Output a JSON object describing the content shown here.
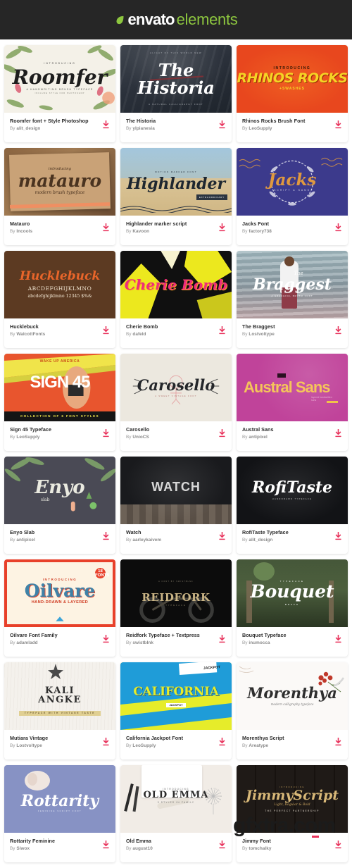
{
  "header": {
    "logo_primary": "envato",
    "logo_secondary": "elements",
    "leaf_icon": "leaf-icon",
    "bg_color": "#262626",
    "accent_color": "#8dc63f"
  },
  "watermark": {
    "text": "gfxtra.com"
  },
  "download_icon_color": "#e8335c",
  "cards": [
    {
      "title": "Roomfer font + Style Photoshop",
      "by_prefix": "By ",
      "author": "alit_design",
      "thumb": {
        "class": "t-roomfer",
        "top": "INTRODUCING",
        "main": "Roomfer",
        "sub": "A HANDWRITING BRUSH TYPEFACE",
        "sub2": "INCLUDE STYLE FOR PHOTOSHOP"
      }
    },
    {
      "title": "The Historia",
      "by_prefix": "By ",
      "author": "ylpianesia",
      "thumb": {
        "class": "t-historia",
        "top": "ALIGHT OF THIS WORLD NEW",
        "main": "The Historia",
        "sub": "A NATURAL CALLIGRAPHY FONT",
        "sub2": ""
      }
    },
    {
      "title": "Rhinos Rocks Brush Font",
      "by_prefix": "By ",
      "author": "LeoSupply",
      "thumb": {
        "class": "t-rhinos",
        "top": "INTRODUCING",
        "main": "RHINOS ROCKS",
        "sub": "+SWASHES",
        "sub2": ""
      }
    },
    {
      "title": "Matauro",
      "by_prefix": "By ",
      "author": "Incools",
      "thumb": {
        "class": "t-matauro",
        "top": "introducing",
        "main": "matauro",
        "sub": "modern brush typeface",
        "sub2": ""
      }
    },
    {
      "title": "Highlander marker script",
      "by_prefix": "By ",
      "author": "Kavoon",
      "thumb": {
        "class": "t-highlander",
        "top": "MOTION MARKER FONT",
        "main": "Highlander",
        "sub": "EXTRAORDINARY",
        "sub2": ""
      }
    },
    {
      "title": "Jacks Font",
      "by_prefix": "By ",
      "author": "factory738",
      "thumb": {
        "class": "t-jacks",
        "top": "",
        "main": "Jacks",
        "sub": "SCRIPT & SANS",
        "sub2": ""
      }
    },
    {
      "title": "Hucklebuck",
      "by_prefix": "By ",
      "author": "WalcottFonts",
      "thumb": {
        "class": "t-huckle",
        "top": "",
        "main": "Hucklebuck",
        "sub": "ABCDEFGHIJKLMNO",
        "sub2": "abcdefghijklmno 12345 $%&"
      }
    },
    {
      "title": "Cherie Bomb",
      "by_prefix": "By ",
      "author": "dafeld",
      "thumb": {
        "class": "t-cherie",
        "top": "",
        "main": "Cherie Bomb",
        "sub": "",
        "sub2": ""
      }
    },
    {
      "title": "The Braggest",
      "by_prefix": "By ",
      "author": "Lostvoltype",
      "thumb": {
        "class": "t-braggest",
        "top": "The",
        "main": "Braggest",
        "sub": "A GRACEFUL BRUSH FONT",
        "sub2": ""
      }
    },
    {
      "title": "Sign 45 Typeface",
      "by_prefix": "By ",
      "author": "LeoSupply",
      "thumb": {
        "class": "t-sign45",
        "top": "WAKE UP AMERICA",
        "main": "SIGN 45",
        "sub": "COLLECTION OF 6 FONT STYLES",
        "sub2": ""
      }
    },
    {
      "title": "Carosello",
      "by_prefix": "By ",
      "author": "UnioCS",
      "thumb": {
        "class": "t-carosello",
        "top": "",
        "main": "Carosello",
        "sub": "A SWEET VINTAGE FONT",
        "sub2": ""
      }
    },
    {
      "title": "Austral Sans",
      "by_prefix": "By ",
      "author": "antipixel",
      "thumb": {
        "class": "t-austral",
        "top": "",
        "main": "Austral Sans",
        "sub": "layered handwritten sans",
        "sub2": ""
      }
    },
    {
      "title": "Enyo Slab",
      "by_prefix": "By ",
      "author": "antipixel",
      "thumb": {
        "class": "t-enyo",
        "top": "",
        "main": "Enyo",
        "sub": "slab",
        "sub2": ""
      }
    },
    {
      "title": "Watch",
      "by_prefix": "By ",
      "author": "aarleykaivem",
      "thumb": {
        "class": "t-watch",
        "top": "",
        "main": "WATCH",
        "sub": "",
        "sub2": ""
      }
    },
    {
      "title": "RofiTaste Typeface",
      "by_prefix": "By ",
      "author": "alit_design",
      "thumb": {
        "class": "t-rofi",
        "top": "",
        "main": "RofiTaste",
        "sub": "HANDDRAWN TYPEFACE",
        "sub2": ""
      }
    },
    {
      "title": "Oilvare Font Family",
      "by_prefix": "By ",
      "author": "adamladd",
      "thumb": {
        "class": "t-oilvare",
        "top": "INTRODUCING",
        "main": "Oilvare",
        "sub": "HAND-DRAWN & LAYERED",
        "sub2": "18 FONTS"
      }
    },
    {
      "title": "Reidfork Typeface + Textpress",
      "by_prefix": "By ",
      "author": "swistblnk",
      "thumb": {
        "class": "t-reidfork",
        "top": "A FONT BY SWISTBLNK",
        "main": "REIDFORK",
        "sub": "TYPEFACE",
        "sub2": ""
      }
    },
    {
      "title": "Bouquet Typeface",
      "by_prefix": "By ",
      "author": "inumocca",
      "thumb": {
        "class": "t-bouquet",
        "top": "TYPEFACE",
        "main": "Bouquet",
        "sub": "BRAVO",
        "sub2": ""
      }
    },
    {
      "title": "Mutiara Vintage",
      "by_prefix": "By ",
      "author": "Lostvoltype",
      "thumb": {
        "class": "t-mutiara",
        "top": "KALI",
        "main": "ANGKE",
        "sub": "TYPEFACE WITH VINTAGE TASTE",
        "sub2": ""
      }
    },
    {
      "title": "California Jackpot Font",
      "by_prefix": "By ",
      "author": "LeoSupply",
      "thumb": {
        "class": "t-california",
        "top": "JACKPOT",
        "main": "CALIFORNIA",
        "sub": "JACKPOT",
        "sub2": ""
      }
    },
    {
      "title": "Morenthya Script",
      "by_prefix": "By ",
      "author": "Areatype",
      "thumb": {
        "class": "t-morenthya",
        "top": "",
        "main": "Morenthya",
        "sub": "modern calligraphy typeface",
        "sub2": ""
      }
    },
    {
      "title": "Rottarity Feminine",
      "by_prefix": "By ",
      "author": "Siwox",
      "thumb": {
        "class": "t-rottarity",
        "top": "",
        "main": "Rottarity",
        "sub": "FEMININE SCRIPT FONT",
        "sub2": ""
      }
    },
    {
      "title": "Old Emma",
      "by_prefix": "By ",
      "author": "august10",
      "thumb": {
        "class": "t-oldemma",
        "top": "INTRODUCING",
        "main": "OLD EMMA",
        "sub": "3 STYLES IN FAMILY",
        "sub2": ""
      }
    },
    {
      "title": "Jimmy Font",
      "by_prefix": "By ",
      "author": "tomchalky",
      "thumb": {
        "class": "t-jimmy",
        "top": "INTRODUCING",
        "main": "JimmyScript",
        "sub": "Light, Regular & Bold",
        "sub2": "THE PERFECT PARTNERSHIP"
      }
    }
  ]
}
